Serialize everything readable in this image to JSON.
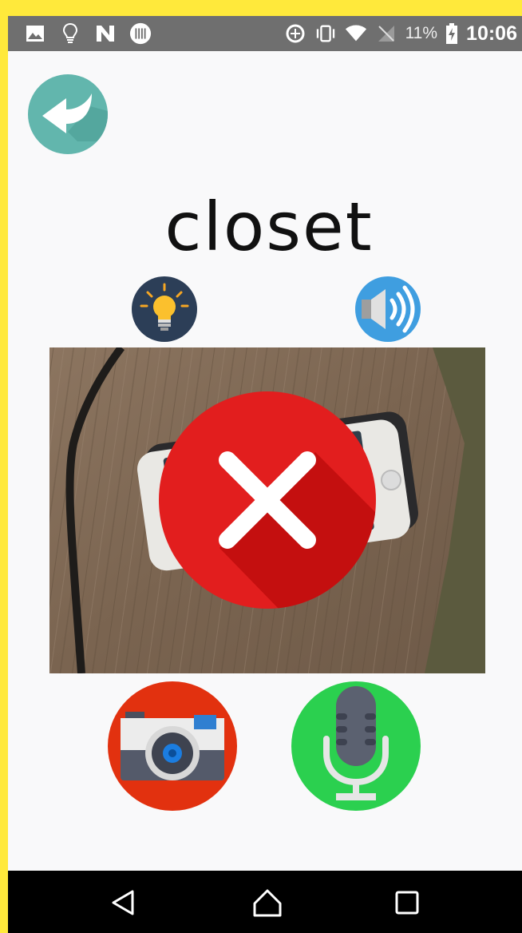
{
  "status_bar": {
    "battery_percent": "11%",
    "time": "10:06",
    "left_icons": [
      "image-icon",
      "lightbulb-icon",
      "n-app-icon",
      "barcode-icon"
    ],
    "right_icons": [
      "data-saver-icon",
      "vibrate-icon",
      "wifi-icon",
      "no-sim-icon",
      "battery-charging-icon"
    ]
  },
  "header": {
    "back_icon": "back-arrow-icon",
    "back_color": "#62b6ad"
  },
  "word": {
    "text": "closet"
  },
  "actions": {
    "hint_icon": "lightbulb-icon",
    "sound_icon": "speaker-icon",
    "camera_icon": "camera-icon",
    "mic_icon": "microphone-icon"
  },
  "result": {
    "status": "incorrect",
    "icon": "close-icon",
    "color": "#e21e1e"
  },
  "nav_bar": {
    "buttons": [
      "back-triangle-icon",
      "home-icon",
      "recents-icon"
    ]
  },
  "colors": {
    "page_border": "#ffe93b",
    "camera_bg": "#e2310f",
    "mic_bg": "#2bd04f",
    "sound_bg": "#3f9ee0",
    "hint_bg": "#2c3e57"
  }
}
